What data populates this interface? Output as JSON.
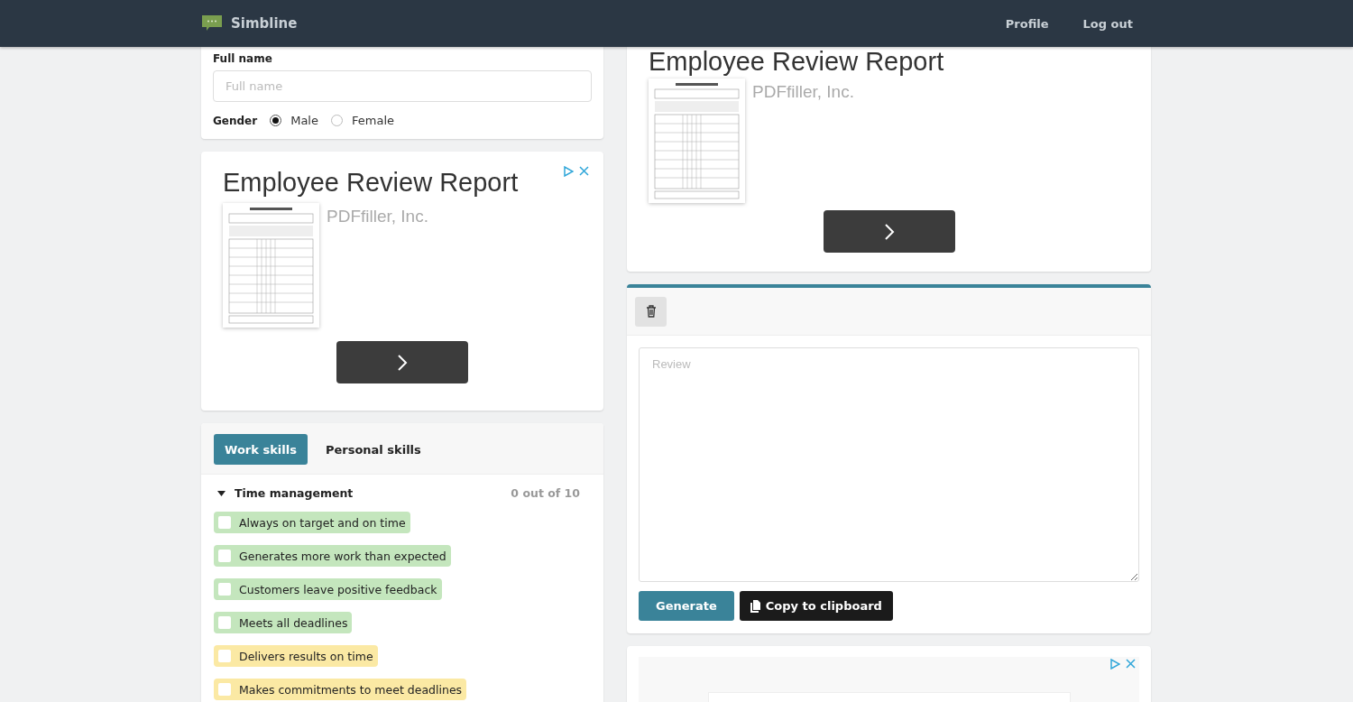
{
  "header": {
    "brand": "Simbline",
    "nav": [
      {
        "label": "Profile"
      },
      {
        "label": "Log out"
      }
    ]
  },
  "form": {
    "full_name": {
      "label": "Full name",
      "placeholder": "Full name"
    },
    "gender": {
      "label": "Gender",
      "options": [
        {
          "label": "Male",
          "selected": true
        },
        {
          "label": "Female",
          "selected": false
        }
      ]
    }
  },
  "ad_left": {
    "title": "Employee Review Report",
    "advertiser": "PDFfiller, Inc."
  },
  "skills": {
    "tabs": [
      {
        "label": "Work skills",
        "selected": true
      },
      {
        "label": "Personal skills",
        "selected": false
      }
    ],
    "groups": [
      {
        "title": "Time management",
        "expanded": true,
        "count": "0 out of 10",
        "items": [
          {
            "label": "Always on target and on time",
            "checked": false,
            "color": "#c4e6bd"
          },
          {
            "label": "Generates more work than expected",
            "checked": false,
            "color": "#c4e6bd"
          },
          {
            "label": "Customers leave positive feedback",
            "checked": false,
            "color": "#c4e6bd"
          },
          {
            "label": "Meets all deadlines",
            "checked": false,
            "color": "#c4e6bd"
          },
          {
            "label": "Delivers results on time",
            "checked": false,
            "color": "#fbe9a4"
          },
          {
            "label": "Makes commitments to meet deadlines",
            "checked": false,
            "color": "#fbe9a4"
          }
        ]
      }
    ]
  },
  "ad_right": {
    "title": "Employee Review Report",
    "advertiser": "PDFfiller, Inc."
  },
  "review": {
    "placeholder": "Review",
    "buttons": [
      {
        "label": "Generate",
        "kind": "primary"
      },
      {
        "label": "Copy to clipboard",
        "kind": "copy"
      }
    ]
  }
}
